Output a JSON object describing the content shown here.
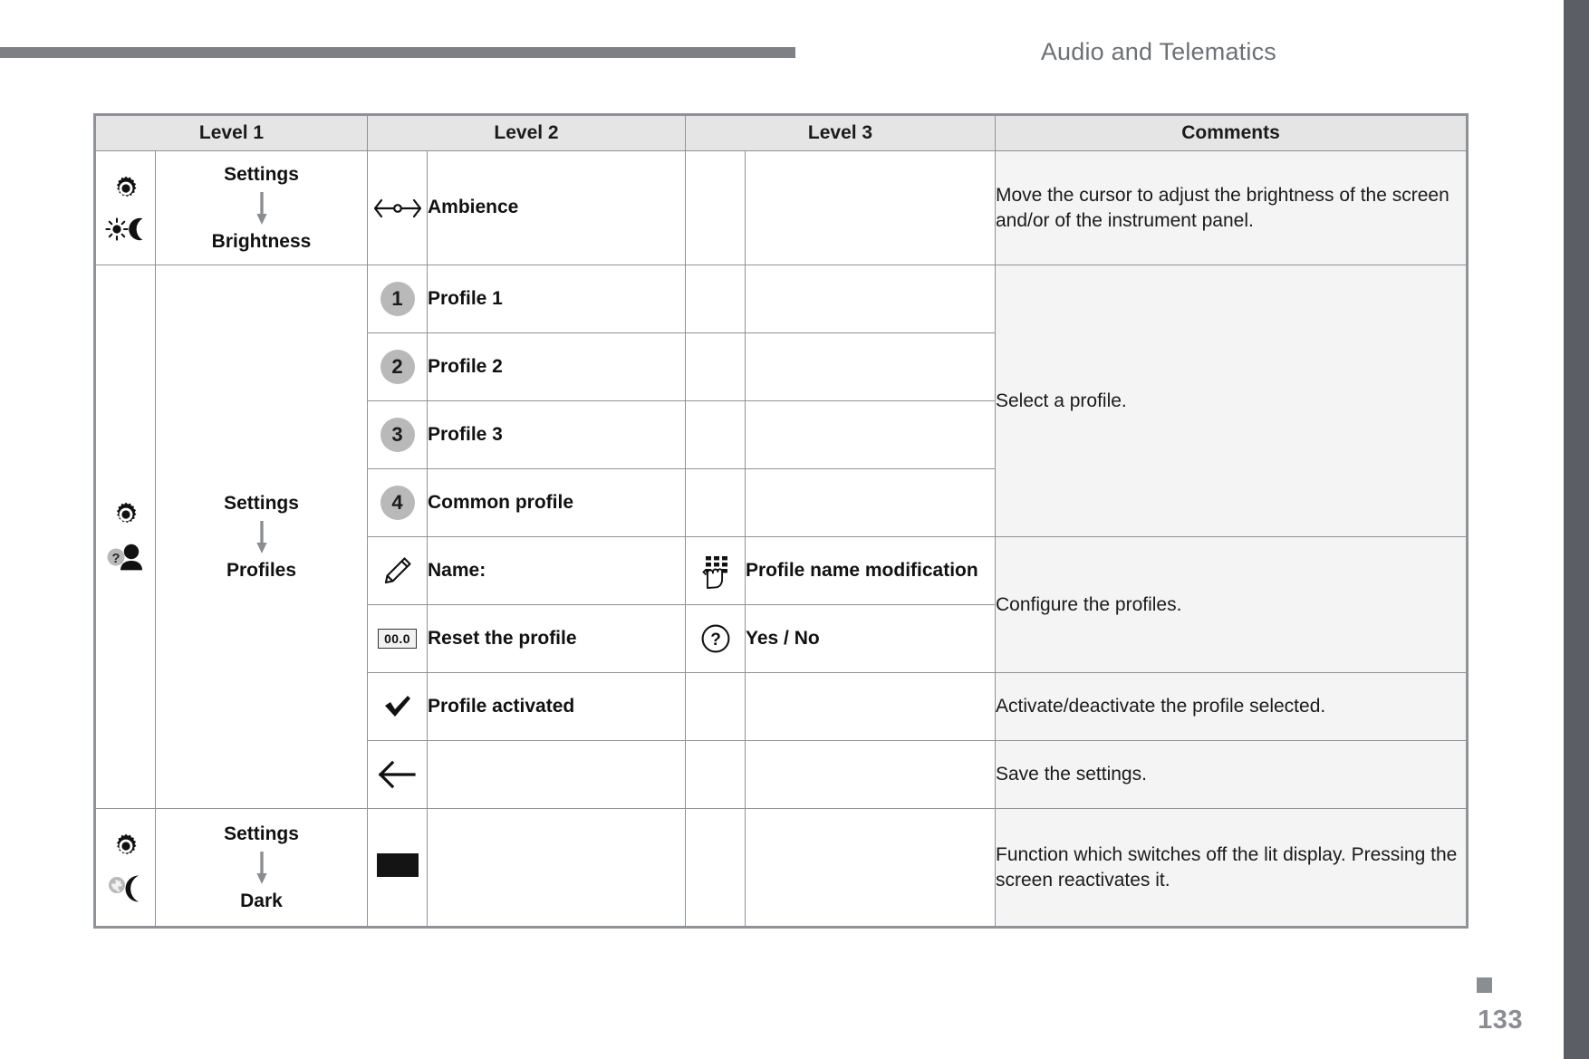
{
  "header": {
    "title": "Audio and Telematics"
  },
  "footer": {
    "page_number": "133",
    "marker": "square-marker"
  },
  "colors": {
    "header_rule": "#7d8084",
    "header_text": "#6d7075",
    "edge_bar": "#5b5e64",
    "table_border": "#8f9296",
    "table_head_bg": "#e5e5e5",
    "comment_bg": "#f4f4f4",
    "badge_bg": "#b9b9b9",
    "arrow": "#8a8d92"
  },
  "table": {
    "columns": [
      "Level 1",
      "Level 2",
      "Level 3",
      "Comments"
    ],
    "groups": [
      {
        "id": "brightness",
        "level1": {
          "icons": [
            "gear-icon",
            "sun-moon-icon"
          ],
          "top": "Settings",
          "bottom": "Brightness"
        },
        "rows": [
          {
            "level2_icon": "cursor-slider-icon",
            "level2": "Ambience",
            "level3_icon": "",
            "level3": "",
            "comment": "Move the cursor to adjust the brightness of the screen and/or of the instrument panel."
          }
        ]
      },
      {
        "id": "profiles",
        "level1": {
          "icons": [
            "gear-icon",
            "person-question-icon"
          ],
          "top": "Settings",
          "bottom": "Profiles"
        },
        "rows": [
          {
            "level2_icon": "badge-1",
            "level2": "Profile 1",
            "level3_icon": "",
            "level3": ""
          },
          {
            "level2_icon": "badge-2",
            "level2": "Profile 2",
            "level3_icon": "",
            "level3": ""
          },
          {
            "level2_icon": "badge-3",
            "level2": "Profile 3",
            "level3_icon": "",
            "level3": ""
          },
          {
            "level2_icon": "badge-4",
            "level2": "Common profile",
            "level3_icon": "",
            "level3": ""
          },
          {
            "level2_icon": "pencil-icon",
            "level2": "Name:",
            "level3_icon": "keyboard-hand-icon",
            "level3": "Profile name modification"
          },
          {
            "level2_icon": "reset-value-icon",
            "level2": "Reset the profile",
            "level3_icon": "question-circle-icon",
            "level3": "Yes / No"
          },
          {
            "level2_icon": "checkmark-icon",
            "level2": "Profile activated",
            "level3_icon": "",
            "level3": ""
          },
          {
            "level2_icon": "back-arrow-icon",
            "level2": "",
            "level3_icon": "",
            "level3": ""
          }
        ],
        "comments": [
          {
            "text": "Select a profile.",
            "span": 4
          },
          {
            "text": "Configure the profiles.",
            "span": 2
          },
          {
            "text": "Activate/deactivate the profile selected.",
            "span": 1
          },
          {
            "text": "Save the settings.",
            "span": 1
          }
        ]
      },
      {
        "id": "dark",
        "level1": {
          "icons": [
            "gear-icon",
            "moon-star-icon"
          ],
          "top": "Settings",
          "bottom": "Dark"
        },
        "rows": [
          {
            "level2_icon": "black-rectangle-icon",
            "level2": "",
            "level3_icon": "",
            "level3": "",
            "comment": "Function which switches off the lit display. Pressing the screen reactivates it."
          }
        ]
      }
    ],
    "misc": {
      "reset_box_label": "00.0",
      "badge_1": "1",
      "badge_2": "2",
      "badge_3": "3",
      "badge_4": "4"
    }
  }
}
